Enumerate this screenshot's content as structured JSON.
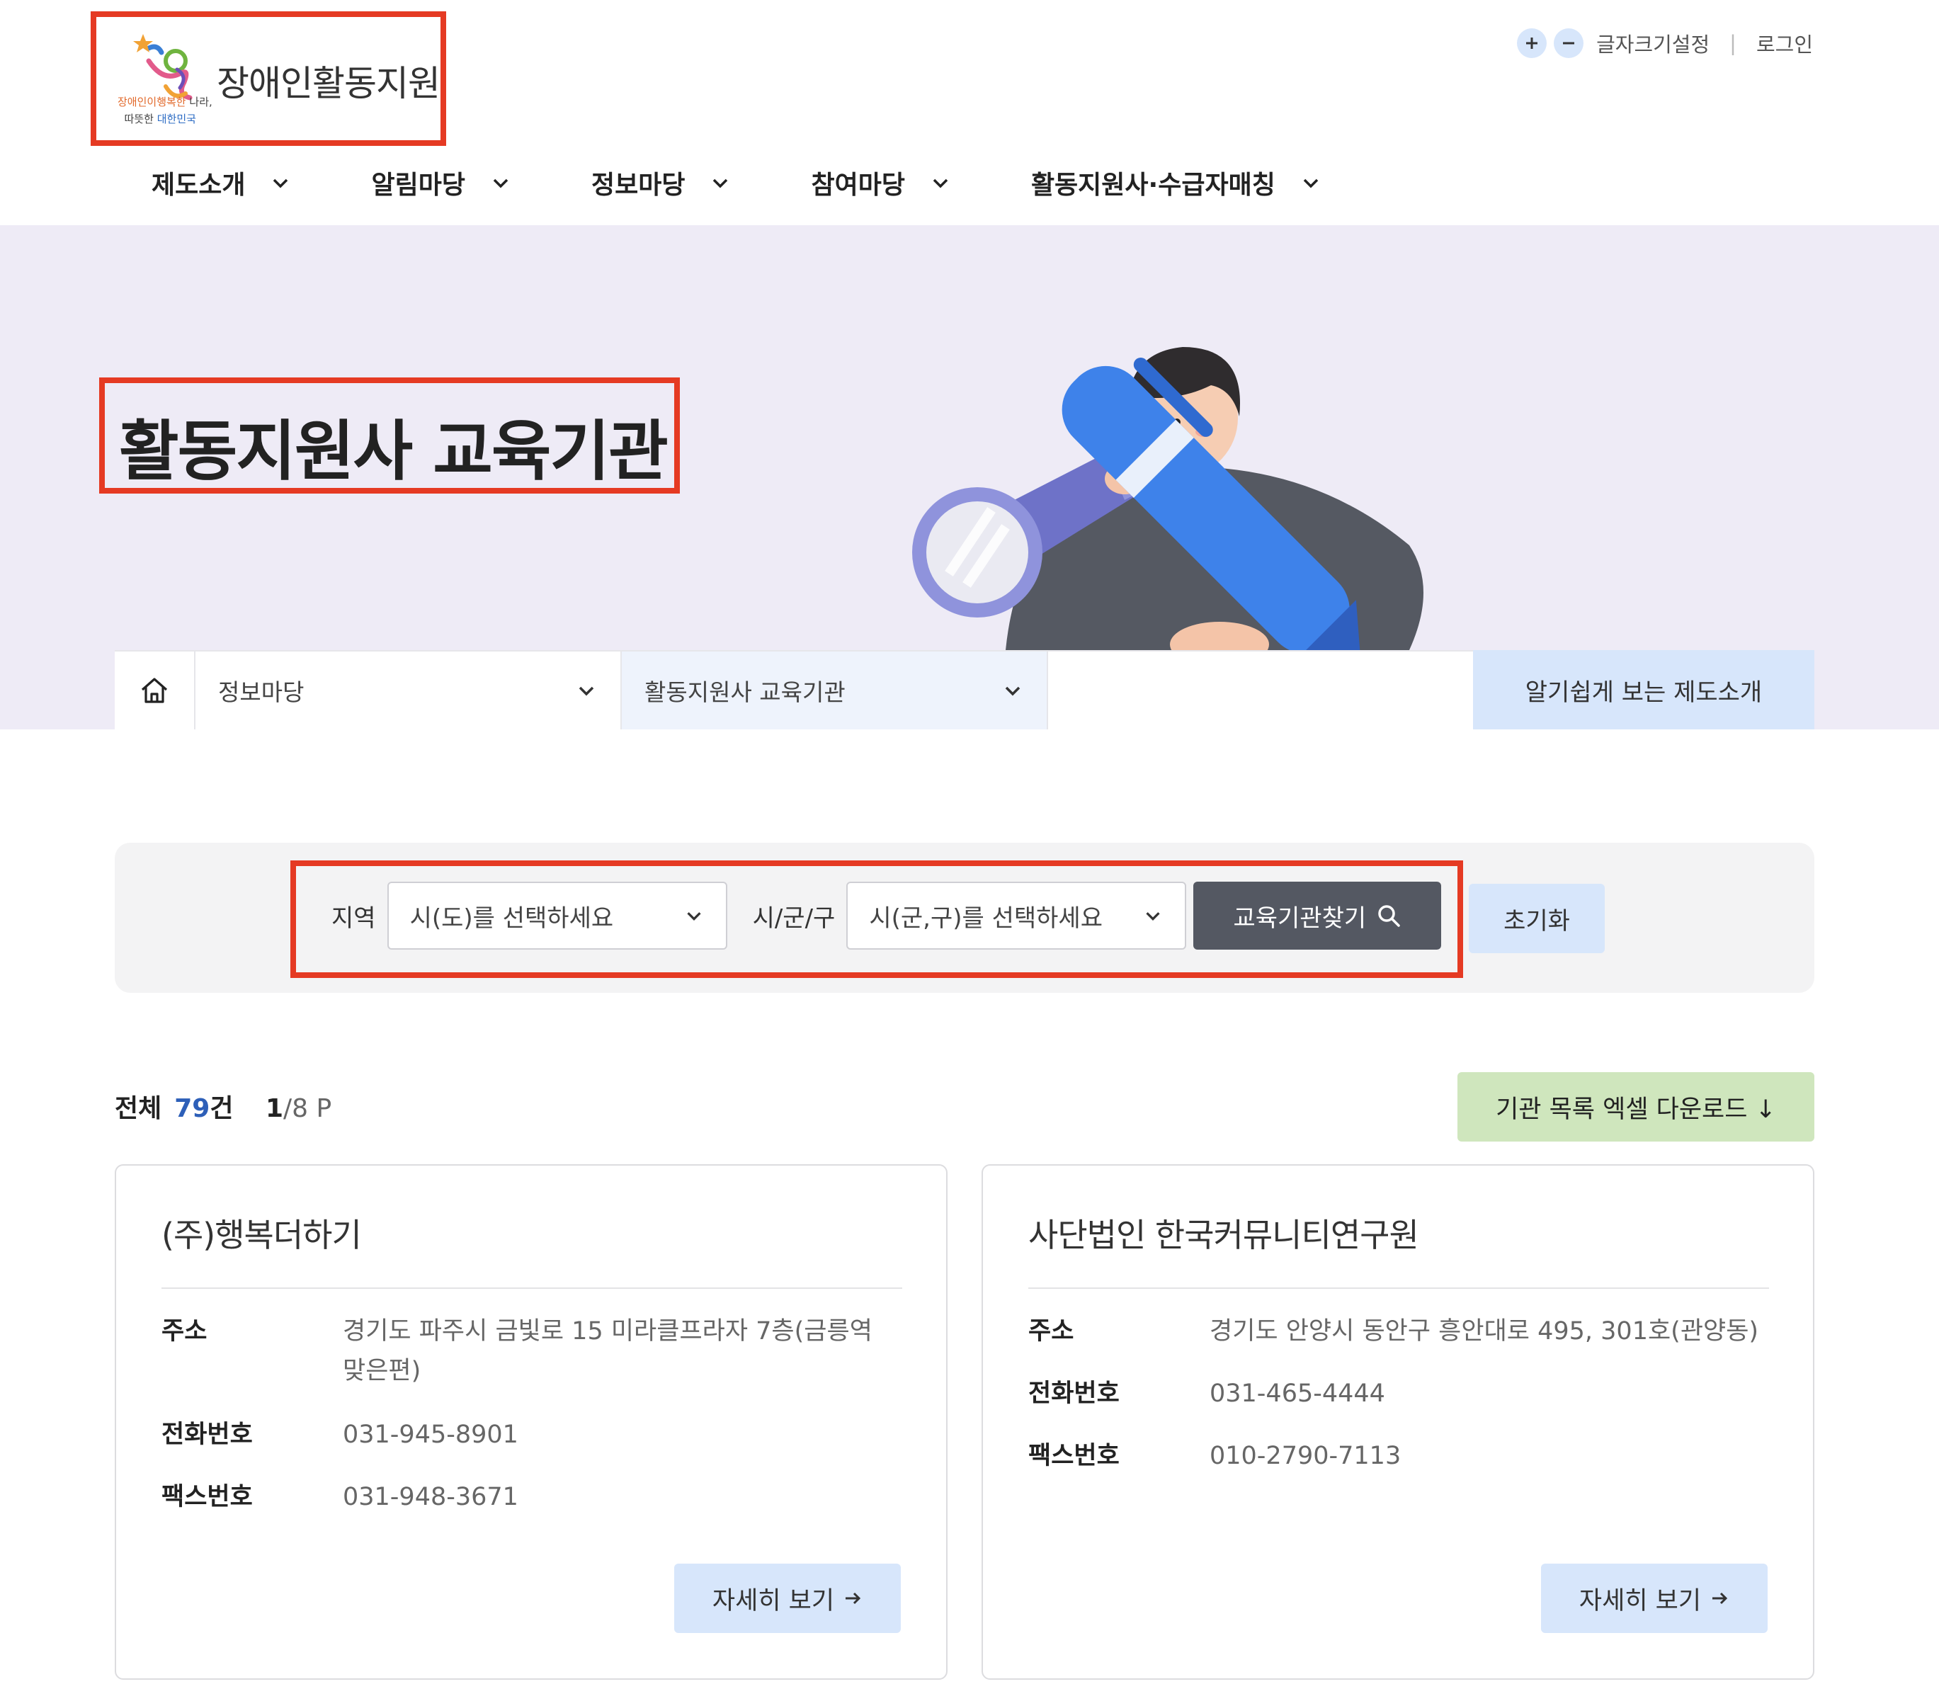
{
  "header": {
    "logo_title": "장애인활동지원",
    "logo_slogan_line1_a": "장애인이",
    "logo_slogan_line1_b": "행복한",
    "logo_slogan_line1_c": "나라,",
    "logo_slogan_line2_a": "따뜻한",
    "logo_slogan_line2_b": "대한민국",
    "font_size_setting": "글자크기설정",
    "login": "로그인",
    "nav": [
      {
        "label": "제도소개"
      },
      {
        "label": "알림마당"
      },
      {
        "label": "정보마당"
      },
      {
        "label": "참여마당"
      },
      {
        "label": "활동지원사·수급자매칭"
      }
    ]
  },
  "hero": {
    "title": "활동지원사 교육기관"
  },
  "breadcrumb": {
    "level1": "정보마당",
    "level2": "활동지원사 교육기관",
    "cta": "알기쉽게 보는 제도소개"
  },
  "search": {
    "region_label": "지역",
    "region_select": "시(도)를 선택하세요",
    "district_label": "시/군/구",
    "district_select": "시(군,구)를 선택하세요",
    "find_button": "교육기관찾기",
    "reset_button": "초기화"
  },
  "results": {
    "total_label": "전체",
    "total_count": "79",
    "count_unit": "건",
    "current_page": "1",
    "total_pages": "/8 P",
    "excel_button": "기관 목록 엑셀 다운로드 ↓"
  },
  "labels": {
    "address": "주소",
    "phone": "전화번호",
    "fax": "팩스번호",
    "detail_button": "자세히 보기"
  },
  "institutions": [
    {
      "name": "(주)행복더하기",
      "address": "경기도 파주시 금빛로 15 미라클프라자 7층(금릉역 맞은편)",
      "phone": "031-945-8901",
      "fax": "031-948-3671"
    },
    {
      "name": "사단법인 한국커뮤니티연구원",
      "address": "경기도 안양시 동안구 흥안대로 495, 301호(관양동)",
      "phone": "031-465-4444",
      "fax": "010-2790-7113"
    }
  ],
  "colors": {
    "highlight_border": "#e53a23",
    "hero_bg": "#eeebf6",
    "accent_blue_light": "#d7e6fb",
    "excel_green": "#cfe6bd",
    "dark_button": "#545862",
    "count_blue": "#2d5fb8"
  },
  "icons": [
    "home-icon",
    "chevron-down-icon",
    "search-icon",
    "arrow-right-icon",
    "plus-icon",
    "minus-icon"
  ]
}
